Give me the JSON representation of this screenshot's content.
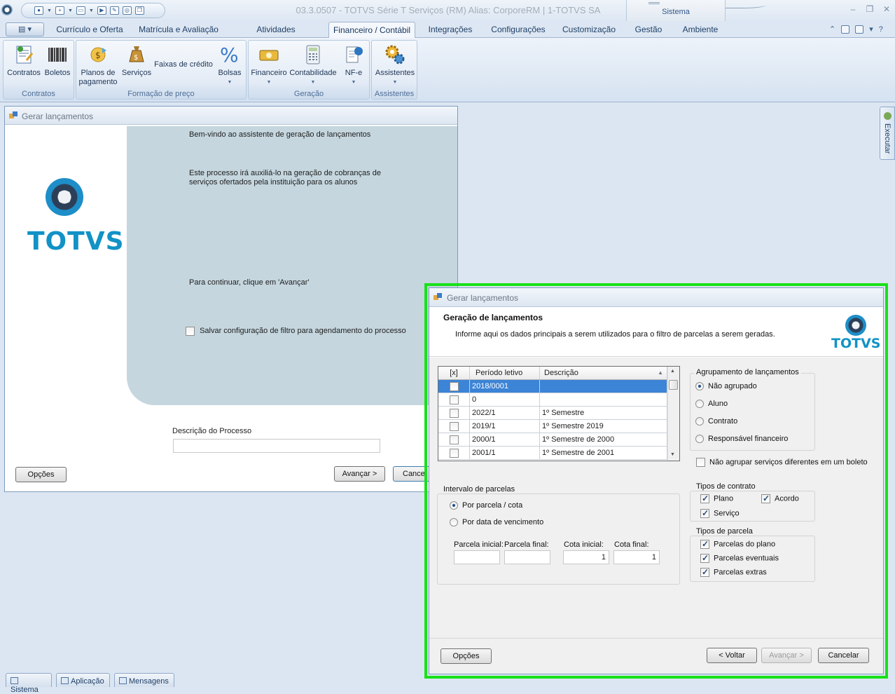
{
  "window": {
    "title": "03.3.0507 - TOTVS Série T Serviços (RM) Alias: CorporeRM | 1-TOTVS SA",
    "context_group": "Sistema"
  },
  "ribbon": {
    "tabs": [
      {
        "label": "Currículo e Oferta"
      },
      {
        "label": "Matrícula e Avaliação"
      },
      {
        "label": "Atividades acadêmicas"
      },
      {
        "label": "Financeiro / Contábil"
      },
      {
        "label": "Integrações"
      },
      {
        "label": "Configurações"
      },
      {
        "label": "Customização"
      },
      {
        "label": "Gestão"
      },
      {
        "label": "Ambiente"
      }
    ],
    "active_tab": "Financeiro / Contábil",
    "groups": {
      "contratos": {
        "label": "Contratos",
        "buttons": [
          "Contratos",
          "Boletos"
        ]
      },
      "formacao": {
        "label": "Formação de preço",
        "buttons": [
          "Planos de pagamento",
          "Serviços",
          "Faixas de crédito",
          "Bolsas"
        ]
      },
      "geracao": {
        "label": "Geração",
        "buttons": [
          "Financeiro",
          "Contabilidade",
          "NF-e"
        ]
      },
      "assistentes": {
        "label": "Assistentes",
        "buttons": [
          "Assistentes"
        ]
      }
    }
  },
  "side_panel": {
    "label": "Executar"
  },
  "status_tabs": [
    "Sistema",
    "Aplicação",
    "Mensagens"
  ],
  "background_wizard": {
    "title": "Gerar lançamentos",
    "logo_text": "TOTVS",
    "welcome": "Bem-vindo ao assistente de geração de lançamentos",
    "intro_line1": "Este processo irá auxiliá-lo na geração de cobranças de",
    "intro_line2": "serviços ofertados pela instituição para os alunos",
    "continue_text": "Para continuar, clique em 'Avançar'",
    "save_filter_label": "Salvar configuração de filtro para agendamento do processo",
    "description_label": "Descrição do Processo",
    "description_value": "",
    "options_button": "Opções",
    "next_button": "Avançar >",
    "cancel_button": "Cance"
  },
  "dialog": {
    "title": "Gerar lançamentos",
    "header_title": "Geração de lançamentos",
    "header_subtitle": "Informe aqui os dados principais a serem utilizados para o filtro de parcelas a serem geradas.",
    "logo_text": "TOTVS",
    "grid": {
      "columns": [
        "[x]",
        "Período letivo",
        "Descrição"
      ],
      "rows": [
        {
          "checked": false,
          "periodo": "2018/0001",
          "descricao": "",
          "selected": true
        },
        {
          "checked": false,
          "periodo": "0",
          "descricao": "",
          "selected": false
        },
        {
          "checked": false,
          "periodo": "2022/1",
          "descricao": "1º Semestre",
          "selected": false
        },
        {
          "checked": false,
          "periodo": "2019/1",
          "descricao": "1º Semestre 2019",
          "selected": false
        },
        {
          "checked": false,
          "periodo": "2000/1",
          "descricao": "1º Semestre de 2000",
          "selected": false
        },
        {
          "checked": false,
          "periodo": "2001/1",
          "descricao": "1º Semestre de 2001",
          "selected": false
        }
      ]
    },
    "agrupamento": {
      "title": "Agrupamento de lançamentos",
      "options": [
        "Não agrupado",
        "Aluno",
        "Contrato",
        "Responsável financeiro"
      ],
      "selected": "Não agrupado"
    },
    "nao_agrupar_label": "Não agrupar serviços diferentes em um boleto",
    "intervalo": {
      "title": "Intervalo de parcelas",
      "options": [
        "Por parcela / cota",
        "Por data de vencimento"
      ],
      "selected": "Por parcela / cota",
      "parcela_inicial_label": "Parcela inicial:",
      "parcela_final_label": "Parcela final:",
      "cota_inicial_label": "Cota inicial:",
      "cota_final_label": "Cota final:",
      "parcela_inicial": "",
      "parcela_final": "",
      "cota_inicial": "1",
      "cota_final": "1"
    },
    "tipos_contrato": {
      "title": "Tipos de contrato",
      "plano": "Plano",
      "acordo": "Acordo",
      "servico": "Serviço"
    },
    "tipos_parcela": {
      "title": "Tipos de parcela",
      "plano": "Parcelas do plano",
      "eventuais": "Parcelas eventuais",
      "extras": "Parcelas extras"
    },
    "buttons": {
      "options": "Opções",
      "back": "< Voltar",
      "next": "Avançar >",
      "cancel": "Cancelar"
    }
  }
}
